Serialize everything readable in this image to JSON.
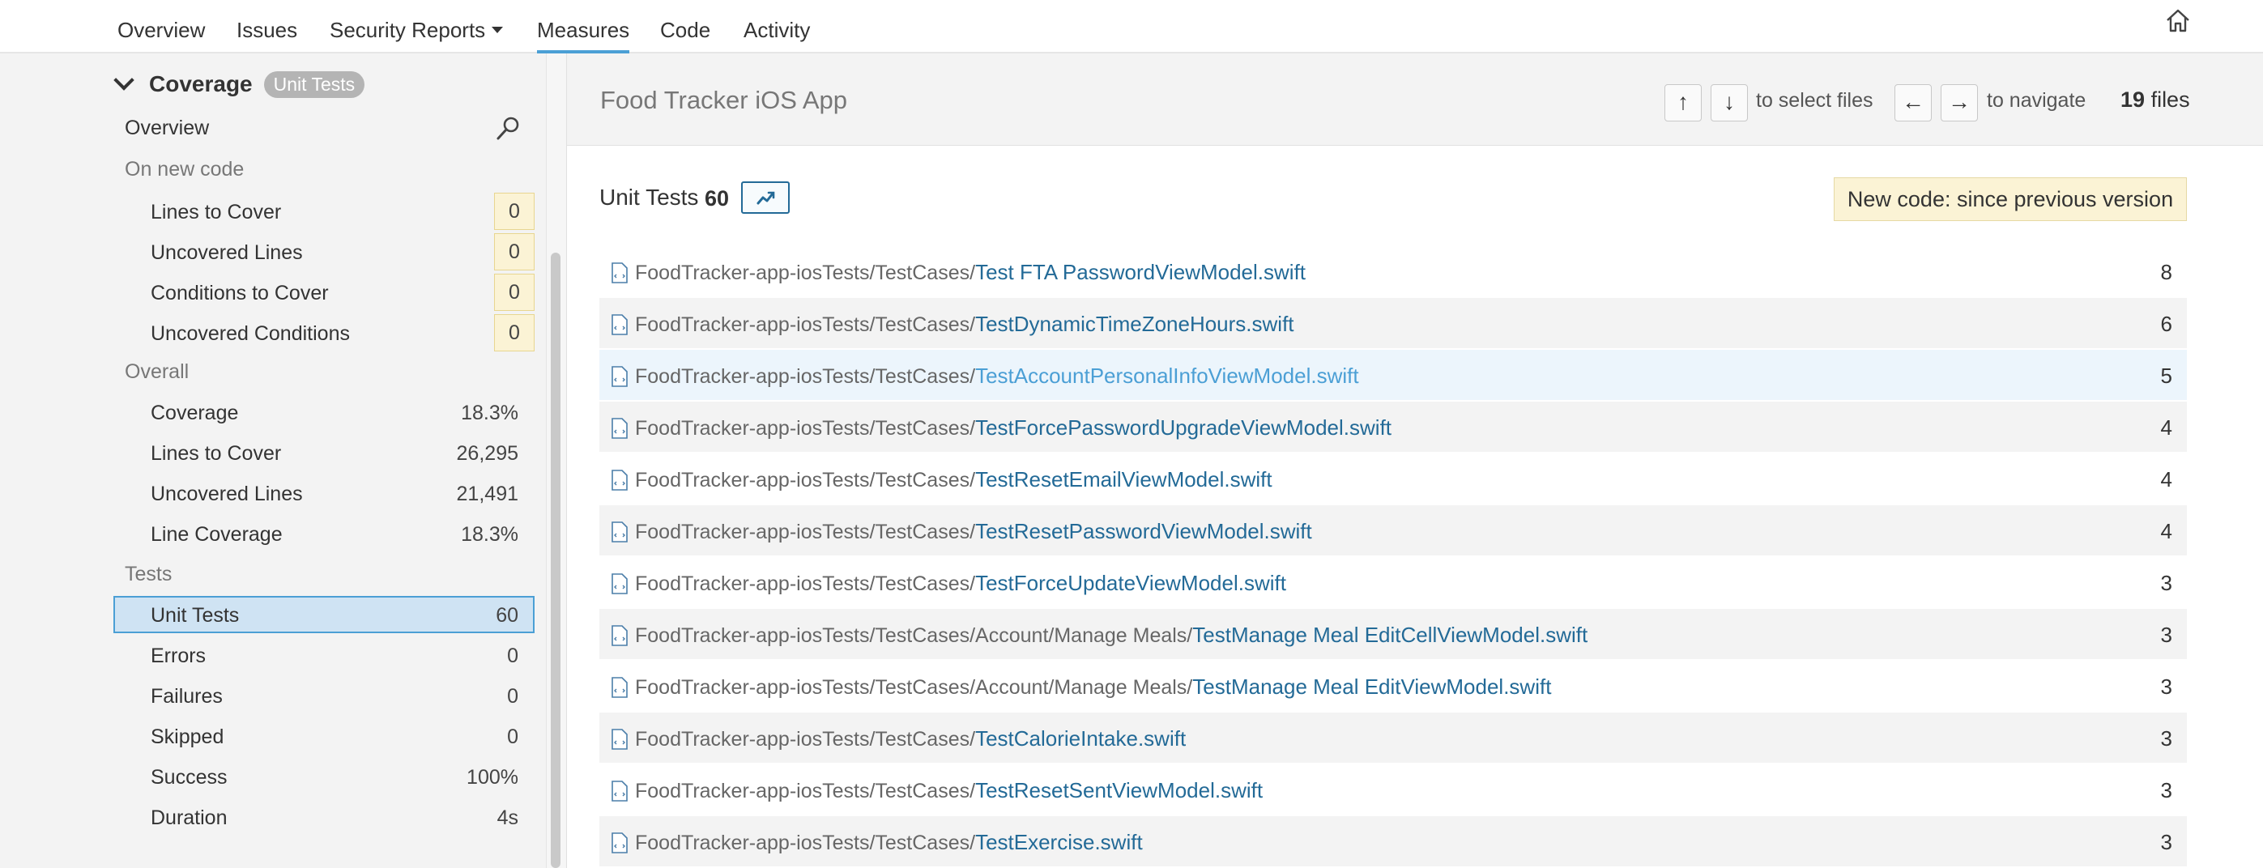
{
  "nav": {
    "tabs": [
      {
        "label": "Overview"
      },
      {
        "label": "Issues"
      },
      {
        "label": "Security Reports"
      },
      {
        "label": "Measures"
      },
      {
        "label": "Code"
      },
      {
        "label": "Activity"
      }
    ],
    "active_tab": "Measures"
  },
  "sidebar": {
    "section_title": "Coverage",
    "badge": "Unit Tests",
    "overview_label": "Overview",
    "new_code_label": "On new code",
    "new_code_items": [
      {
        "label": "Lines to Cover",
        "value": "0"
      },
      {
        "label": "Uncovered Lines",
        "value": "0"
      },
      {
        "label": "Conditions to Cover",
        "value": "0"
      },
      {
        "label": "Uncovered Conditions",
        "value": "0"
      }
    ],
    "overall_label": "Overall",
    "overall_items": [
      {
        "label": "Coverage",
        "value": "18.3%"
      },
      {
        "label": "Lines to Cover",
        "value": "26,295"
      },
      {
        "label": "Uncovered Lines",
        "value": "21,491"
      },
      {
        "label": "Line Coverage",
        "value": "18.3%"
      }
    ],
    "tests_label": "Tests",
    "tests_items": [
      {
        "label": "Unit Tests",
        "value": "60"
      },
      {
        "label": "Errors",
        "value": "0"
      },
      {
        "label": "Failures",
        "value": "0"
      },
      {
        "label": "Skipped",
        "value": "0"
      },
      {
        "label": "Success",
        "value": "100%"
      },
      {
        "label": "Duration",
        "value": "4s"
      }
    ]
  },
  "header": {
    "project": "Food Tracker iOS App",
    "up_key": "↑",
    "down_key": "↓",
    "select_hint": "to select files",
    "left_key": "←",
    "right_key": "→",
    "navigate_hint": "to navigate",
    "files_number": "19",
    "files_label": "files"
  },
  "metric": {
    "name": "Unit Tests",
    "value": "60",
    "new_code_period": "New code: since previous version"
  },
  "files": [
    {
      "path": "FoodTracker-app-iosTests/TestCases/",
      "name": "Test FTA PasswordViewModel.swift",
      "count": "8"
    },
    {
      "path": "FoodTracker-app-iosTests/TestCases/",
      "name": "TestDynamicTimeZoneHours.swift",
      "count": "6"
    },
    {
      "path": "FoodTracker-app-iosTests/TestCases/",
      "name": "TestAccountPersonalInfoViewModel.swift",
      "count": "5"
    },
    {
      "path": "FoodTracker-app-iosTests/TestCases/",
      "name": "TestForcePasswordUpgradeViewModel.swift",
      "count": "4"
    },
    {
      "path": "FoodTracker-app-iosTests/TestCases/",
      "name": "TestResetEmailViewModel.swift",
      "count": "4"
    },
    {
      "path": "FoodTracker-app-iosTests/TestCases/",
      "name": "TestResetPasswordViewModel.swift",
      "count": "4"
    },
    {
      "path": "FoodTracker-app-iosTests/TestCases/",
      "name": "TestForceUpdateViewModel.swift",
      "count": "3"
    },
    {
      "path": "FoodTracker-app-iosTests/TestCases/Account/Manage Meals/",
      "name": "TestManage Meal EditCellViewModel.swift",
      "count": "3"
    },
    {
      "path": "FoodTracker-app-iosTests/TestCases/Account/Manage Meals/",
      "name": "TestManage Meal EditViewModel.swift",
      "count": "3"
    },
    {
      "path": "FoodTracker-app-iosTests/TestCases/",
      "name": "TestCalorieIntake.swift",
      "count": "3"
    },
    {
      "path": "FoodTracker-app-iosTests/TestCases/",
      "name": "TestResetSentViewModel.swift",
      "count": "3"
    },
    {
      "path": "FoodTracker-app-iosTests/TestCases/",
      "name": "TestExercise.swift",
      "count": "3"
    }
  ],
  "colors": {
    "accent": "#4b9fd5",
    "link": "#236a97",
    "selected_bg": "#cfe3f3",
    "new_code_bg": "#fbf3d5"
  },
  "icons": {
    "home": "home-icon",
    "search": "search-icon",
    "history": "history-chart-icon",
    "file": "file-icon"
  }
}
